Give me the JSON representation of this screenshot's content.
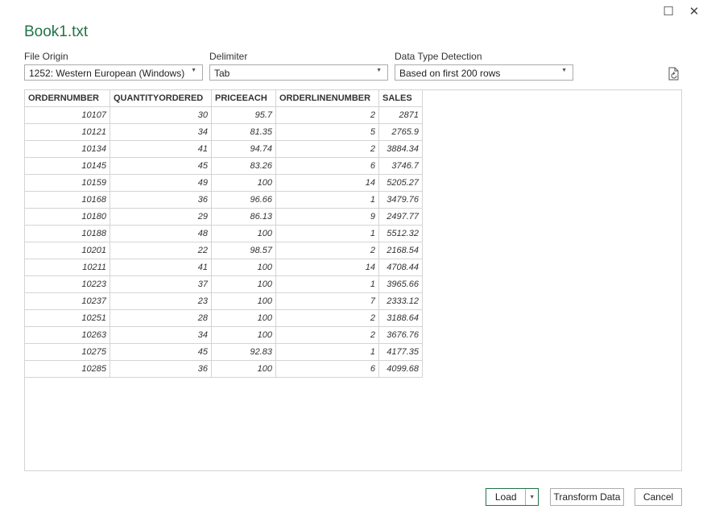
{
  "window": {
    "maximize_icon": "☐",
    "close_icon": "✕"
  },
  "dialog": {
    "title": "Book1.txt"
  },
  "options": {
    "file_origin": {
      "label": "File Origin",
      "value": "1252: Western European (Windows)"
    },
    "delimiter": {
      "label": "Delimiter",
      "value": "Tab"
    },
    "data_type_detection": {
      "label": "Data Type Detection",
      "value": "Based on first 200 rows"
    }
  },
  "table": {
    "headers": [
      "ORDERNUMBER",
      "QUANTITYORDERED",
      "PRICEEACH",
      "ORDERLINENUMBER",
      "SALES"
    ],
    "rows": [
      [
        "10107",
        "30",
        "95.7",
        "2",
        "2871"
      ],
      [
        "10121",
        "34",
        "81.35",
        "5",
        "2765.9"
      ],
      [
        "10134",
        "41",
        "94.74",
        "2",
        "3884.34"
      ],
      [
        "10145",
        "45",
        "83.26",
        "6",
        "3746.7"
      ],
      [
        "10159",
        "49",
        "100",
        "14",
        "5205.27"
      ],
      [
        "10168",
        "36",
        "96.66",
        "1",
        "3479.76"
      ],
      [
        "10180",
        "29",
        "86.13",
        "9",
        "2497.77"
      ],
      [
        "10188",
        "48",
        "100",
        "1",
        "5512.32"
      ],
      [
        "10201",
        "22",
        "98.57",
        "2",
        "2168.54"
      ],
      [
        "10211",
        "41",
        "100",
        "14",
        "4708.44"
      ],
      [
        "10223",
        "37",
        "100",
        "1",
        "3965.66"
      ],
      [
        "10237",
        "23",
        "100",
        "7",
        "2333.12"
      ],
      [
        "10251",
        "28",
        "100",
        "2",
        "3188.64"
      ],
      [
        "10263",
        "34",
        "100",
        "2",
        "3676.76"
      ],
      [
        "10275",
        "45",
        "92.83",
        "1",
        "4177.35"
      ],
      [
        "10285",
        "36",
        "100",
        "6",
        "4099.68"
      ]
    ]
  },
  "buttons": {
    "load": "Load",
    "transform": "Transform Data",
    "cancel": "Cancel"
  },
  "colors": {
    "accent": "#217346",
    "border": "#d4d4d4"
  }
}
